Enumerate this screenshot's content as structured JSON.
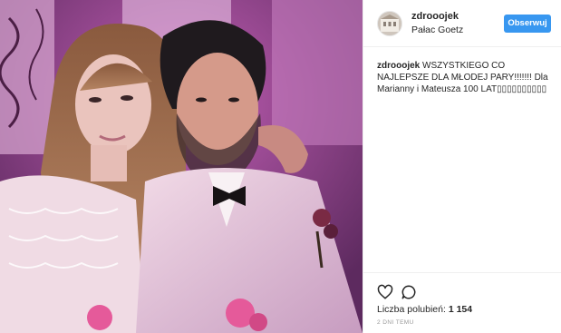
{
  "post": {
    "username": "zdrooojek",
    "location": "Pałac Goetz",
    "follow_label": "Obserwuj",
    "caption": {
      "user": "zdrooojek",
      "text": "WSZYSTKIEGO CO NAJLEPSZE DLA MŁODEJ PARY!!!!!!! Dla Marianny i Mateusza 100 LAT▯▯▯▯▯▯▯▯▯▯"
    },
    "likes": {
      "label": "Liczba polubień:",
      "count": "1 154"
    },
    "timestamp": "2 DNI TEMU",
    "icons": [
      "heart-icon",
      "comment-icon"
    ]
  },
  "colors": {
    "follow_button": "#3897f0",
    "background": "#7b3c79",
    "text": "#262626",
    "muted": "#999999"
  }
}
